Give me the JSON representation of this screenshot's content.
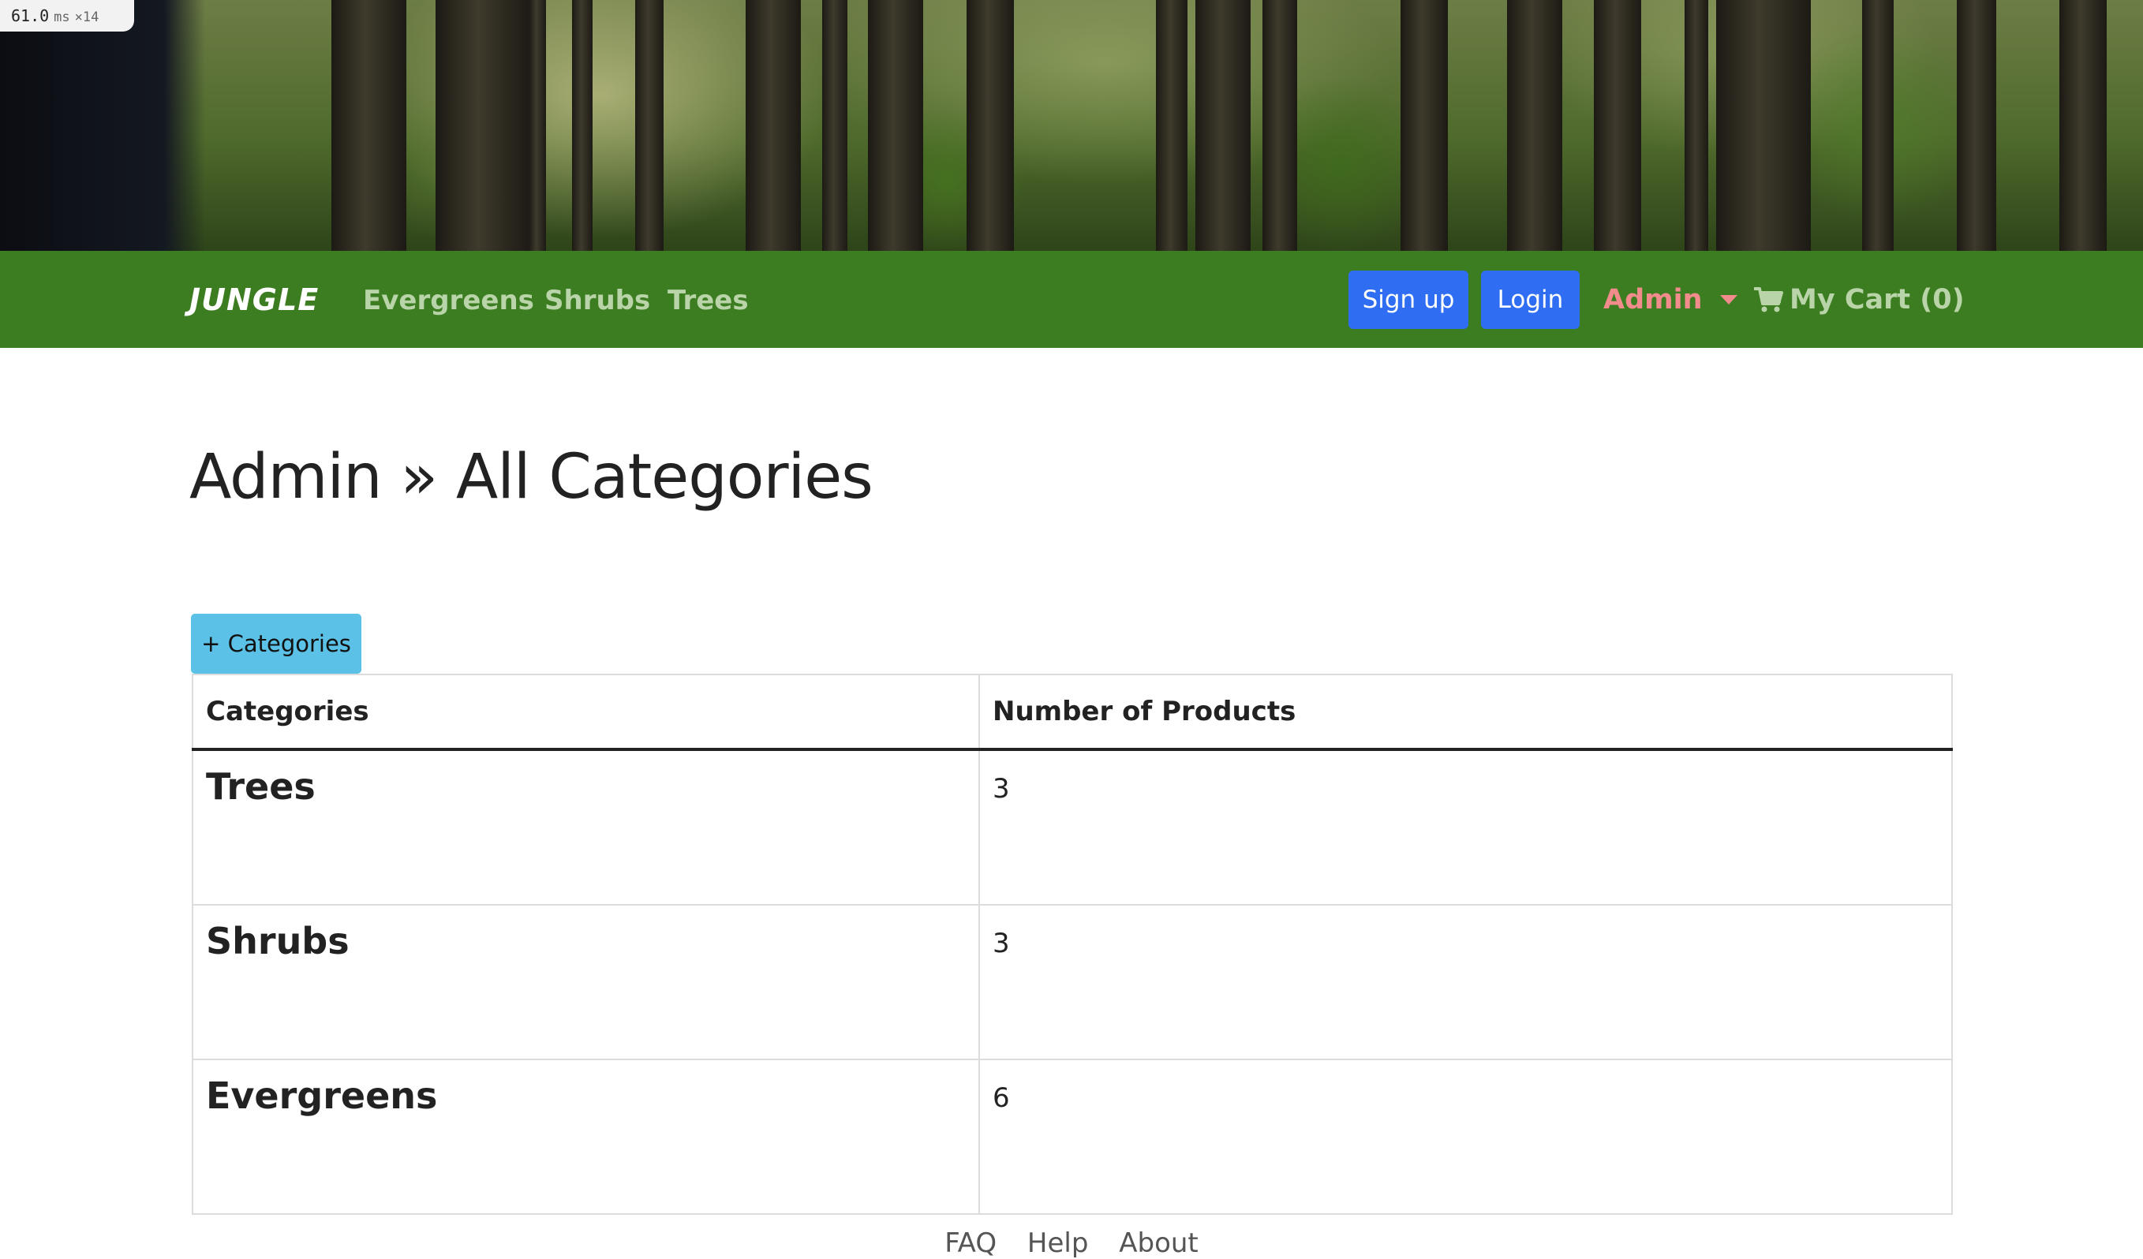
{
  "debug": {
    "fps_value": "61.0",
    "fps_unit": "ms",
    "fps_multiplier": "×14"
  },
  "navbar": {
    "brand": "JUNGLE",
    "links": [
      "Evergreens",
      "Shrubs",
      "Trees"
    ],
    "signup_label": "Sign up",
    "login_label": "Login",
    "admin_label": "Admin",
    "cart_label": "My Cart (0)"
  },
  "page": {
    "title": "Admin » All Categories",
    "add_button_label": "+ Categories"
  },
  "table": {
    "headers": [
      "Categories",
      "Number of Products"
    ],
    "rows": [
      {
        "name": "Trees",
        "count": "3"
      },
      {
        "name": "Shrubs",
        "count": "3"
      },
      {
        "name": "Evergreens",
        "count": "6"
      }
    ]
  },
  "footer": {
    "links": [
      "FAQ",
      "Help",
      "About"
    ]
  },
  "colors": {
    "navbar": "#3c7d21",
    "nav_link": "#b9d4a8",
    "admin": "#f28c8c",
    "primary_button": "#2f6ef2",
    "info_button": "#5bc1e6"
  }
}
